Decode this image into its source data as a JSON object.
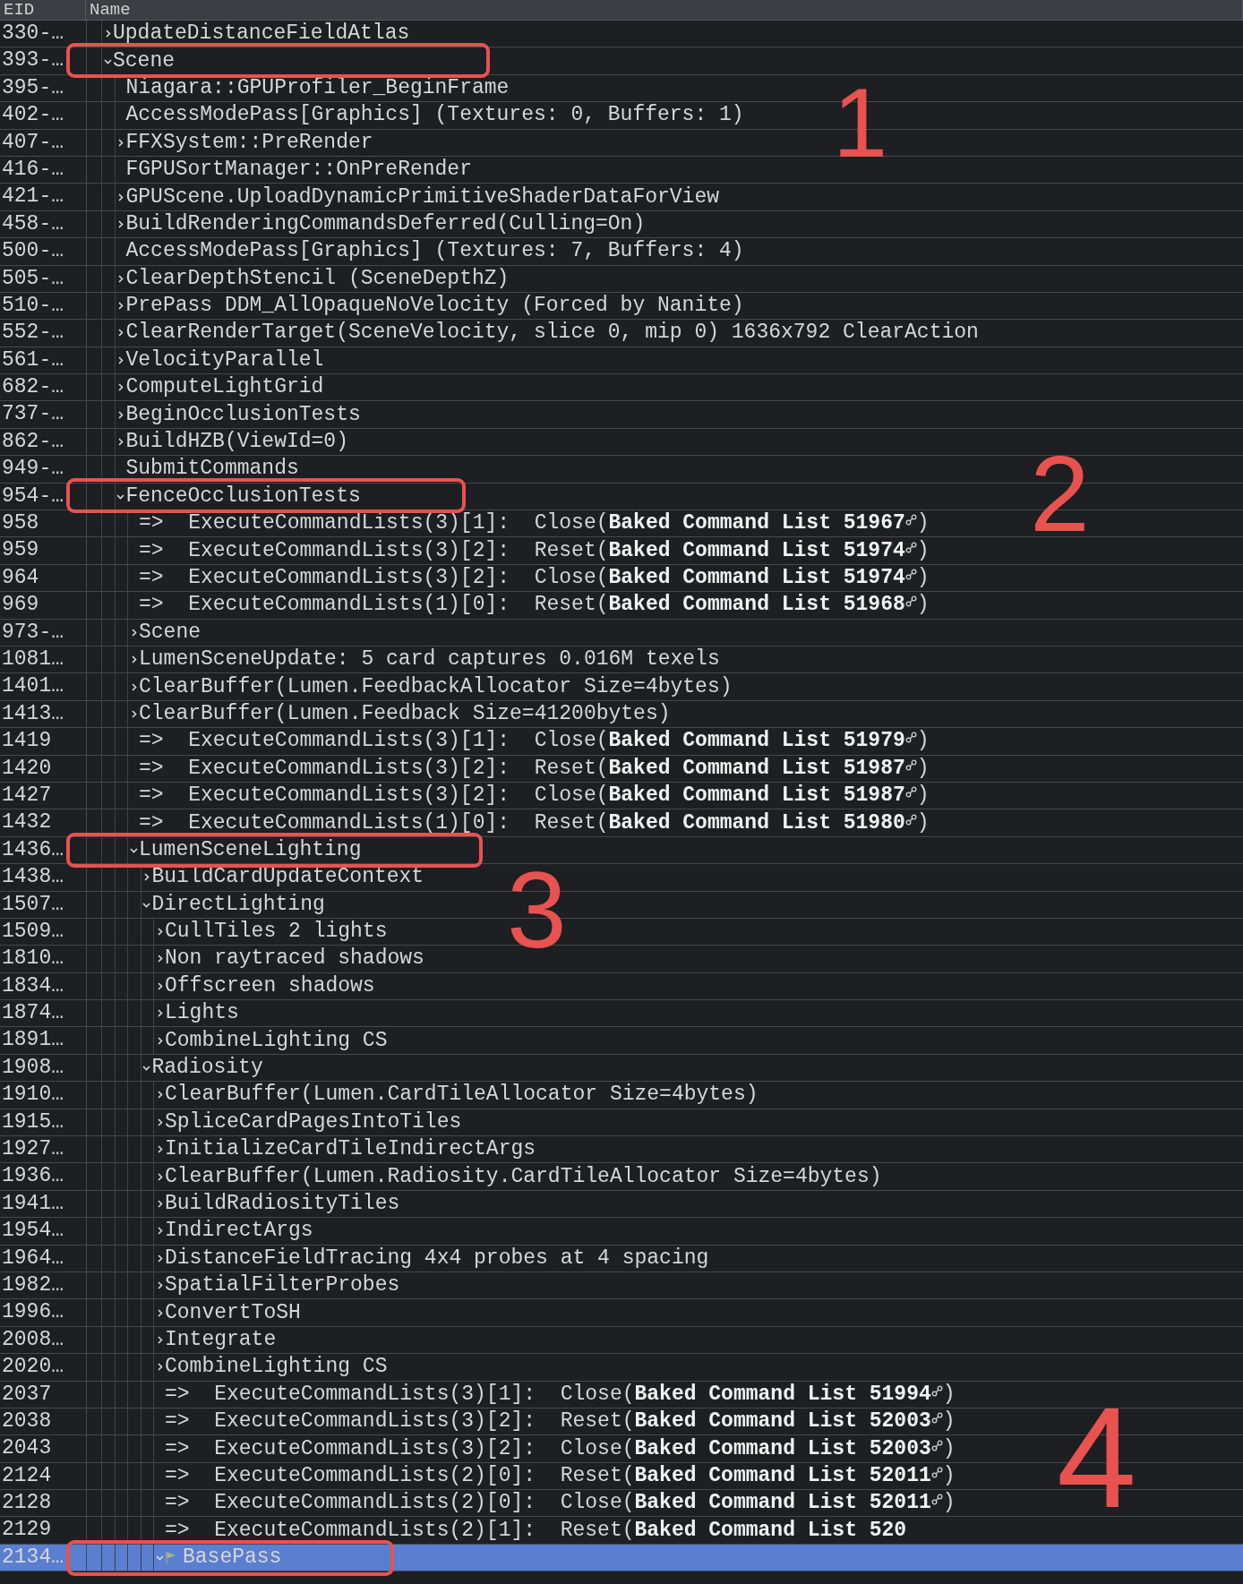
{
  "columns": [
    "EID",
    "Name"
  ],
  "events": [
    {
      "eid": "330-…",
      "kind": "event",
      "name": "UpdateDistanceFieldAtlas",
      "expanded": false,
      "selected": false
    },
    {
      "eid": "393-…",
      "kind": "event",
      "name": "Scene",
      "expanded": true,
      "selected": false,
      "children": [
        {
          "eid": "395-…",
          "kind": "event",
          "name": "Niagara::GPUProfiler_BeginFrame",
          "selected": false
        },
        {
          "eid": "402-…",
          "kind": "event",
          "name": "AccessModePass[Graphics] (Textures: 0, Buffers: 1)",
          "selected": false
        },
        {
          "eid": "407-…",
          "kind": "event",
          "name": "FFXSystem::PreRender",
          "expanded": false,
          "selected": false
        },
        {
          "eid": "416-…",
          "kind": "event",
          "name": "FGPUSortManager::OnPreRender",
          "selected": false
        },
        {
          "eid": "421-…",
          "kind": "event",
          "name": "GPUScene.UploadDynamicPrimitiveShaderDataForView",
          "expanded": false,
          "selected": false
        },
        {
          "eid": "458-…",
          "kind": "event",
          "name": "BuildRenderingCommandsDeferred(Culling=On)",
          "expanded": false,
          "selected": false
        },
        {
          "eid": "500-…",
          "kind": "event",
          "name": "AccessModePass[Graphics] (Textures: 7, Buffers: 4)",
          "selected": false
        },
        {
          "eid": "505-…",
          "kind": "event",
          "name": "ClearDepthStencil (SceneDepthZ)",
          "expanded": false,
          "selected": false
        },
        {
          "eid": "510-…",
          "kind": "event",
          "name": "PrePass DDM_AllOpaqueNoVelocity (Forced by Nanite)",
          "expanded": false,
          "selected": false
        },
        {
          "eid": "552-…",
          "kind": "event",
          "name": "ClearRenderTarget(SceneVelocity, slice 0, mip 0) 1636x792 ClearAction",
          "expanded": false,
          "selected": false
        },
        {
          "eid": "561-…",
          "kind": "event",
          "name": "VelocityParallel",
          "expanded": false,
          "selected": false
        },
        {
          "eid": "682-…",
          "kind": "event",
          "name": "ComputeLightGrid",
          "expanded": false,
          "selected": false
        },
        {
          "eid": "737-…",
          "kind": "event",
          "name": "BeginOcclusionTests",
          "expanded": false,
          "selected": false
        },
        {
          "eid": "862-…",
          "kind": "event",
          "name": "BuildHZB(ViewId=0)",
          "expanded": false,
          "selected": false
        },
        {
          "eid": "949-…",
          "kind": "event",
          "name": "SubmitCommands",
          "selected": false
        },
        {
          "eid": "954-…",
          "kind": "event",
          "name": "FenceOcclusionTests",
          "expanded": true,
          "selected": false,
          "children": [
            {
              "eid": "958",
              "kind": "command",
              "name": "=>  ExecuteCommandLists(3)[1]:  Close(**Baked Command List 51967**",
              "tail": ")",
              "selected": false
            },
            {
              "eid": "959",
              "kind": "command",
              "name": "=>  ExecuteCommandLists(3)[2]:  Reset(**Baked Command List 51974**",
              "tail": ")",
              "selected": false
            },
            {
              "eid": "964",
              "kind": "command",
              "name": "=>  ExecuteCommandLists(3)[2]:  Close(**Baked Command List 51974**",
              "tail": ")",
              "selected": false
            },
            {
              "eid": "969",
              "kind": "command",
              "name": "=>  ExecuteCommandLists(1)[0]:  Reset(**Baked Command List 51968**",
              "tail": ")",
              "selected": false
            },
            {
              "eid": "973-…",
              "kind": "event",
              "name": "Scene",
              "expanded": false,
              "selected": false
            },
            {
              "eid": "1081…",
              "kind": "event",
              "name": "LumenSceneUpdate: 5 card captures 0.016M texels",
              "expanded": false,
              "selected": false
            },
            {
              "eid": "1401…",
              "kind": "event",
              "name": "ClearBuffer(Lumen.FeedbackAllocator Size=4bytes)",
              "expanded": false,
              "selected": false
            },
            {
              "eid": "1413…",
              "kind": "event",
              "name": "ClearBuffer(Lumen.Feedback Size=41200bytes)",
              "expanded": false,
              "selected": false
            },
            {
              "eid": "1419",
              "kind": "command",
              "name": "=>  ExecuteCommandLists(3)[1]:  Close(**Baked Command List 51979**",
              "tail": ")",
              "selected": false
            },
            {
              "eid": "1420",
              "kind": "command",
              "name": "=>  ExecuteCommandLists(3)[2]:  Reset(**Baked Command List 51987**",
              "tail": ")",
              "selected": false
            },
            {
              "eid": "1427",
              "kind": "command",
              "name": "=>  ExecuteCommandLists(3)[2]:  Close(**Baked Command List 51987**",
              "tail": ")",
              "selected": false
            },
            {
              "eid": "1432",
              "kind": "command",
              "name": "=>  ExecuteCommandLists(1)[0]:  Reset(**Baked Command List 51980**",
              "tail": ")",
              "selected": false
            },
            {
              "eid": "1436…",
              "kind": "event",
              "name": "LumenSceneLighting",
              "expanded": true,
              "selected": false,
              "children": [
                {
                  "eid": "1438…",
                  "kind": "event",
                  "name": "BuildCardUpdateContext",
                  "expanded": false,
                  "selected": false
                },
                {
                  "eid": "1507…",
                  "kind": "event",
                  "name": "DirectLighting",
                  "expanded": true,
                  "selected": false,
                  "children": [
                    {
                      "eid": "1509…",
                      "kind": "event",
                      "name": "CullTiles 2 lights",
                      "expanded": false,
                      "selected": false
                    },
                    {
                      "eid": "1810…",
                      "kind": "event",
                      "name": "Non raytraced shadows",
                      "expanded": false,
                      "selected": false
                    },
                    {
                      "eid": "1834…",
                      "kind": "event",
                      "name": "Offscreen shadows",
                      "expanded": false,
                      "selected": false
                    },
                    {
                      "eid": "1874…",
                      "kind": "event",
                      "name": "Lights",
                      "expanded": false,
                      "selected": false
                    },
                    {
                      "eid": "1891…",
                      "kind": "event",
                      "name": "CombineLighting CS",
                      "expanded": false,
                      "selected": false
                    }
                  ]
                },
                {
                  "eid": "1908…",
                  "kind": "event",
                  "name": "Radiosity",
                  "expanded": true,
                  "selected": false,
                  "children": [
                    {
                      "eid": "1910…",
                      "kind": "event",
                      "name": "ClearBuffer(Lumen.CardTileAllocator Size=4bytes)",
                      "expanded": false,
                      "selected": false
                    },
                    {
                      "eid": "1915…",
                      "kind": "event",
                      "name": "SpliceCardPagesIntoTiles",
                      "expanded": false,
                      "selected": false
                    },
                    {
                      "eid": "1927…",
                      "kind": "event",
                      "name": "InitializeCardTileIndirectArgs",
                      "expanded": false,
                      "selected": false
                    },
                    {
                      "eid": "1936…",
                      "kind": "event",
                      "name": "ClearBuffer(Lumen.Radiosity.CardTileAllocator Size=4bytes)",
                      "expanded": false,
                      "selected": false
                    },
                    {
                      "eid": "1941…",
                      "kind": "event",
                      "name": "BuildRadiosityTiles",
                      "expanded": false,
                      "selected": false
                    },
                    {
                      "eid": "1954…",
                      "kind": "event",
                      "name": "IndirectArgs",
                      "expanded": false,
                      "selected": false
                    },
                    {
                      "eid": "1964…",
                      "kind": "event",
                      "name": "DistanceFieldTracing 4x4 probes at 4 spacing",
                      "expanded": false,
                      "selected": false
                    },
                    {
                      "eid": "1982…",
                      "kind": "event",
                      "name": "SpatialFilterProbes",
                      "expanded": false,
                      "selected": false
                    },
                    {
                      "eid": "1996…",
                      "kind": "event",
                      "name": "ConvertToSH",
                      "expanded": false,
                      "selected": false
                    },
                    {
                      "eid": "2008…",
                      "kind": "event",
                      "name": "Integrate",
                      "expanded": false,
                      "selected": false
                    },
                    {
                      "eid": "2020…",
                      "kind": "event",
                      "name": "CombineLighting CS",
                      "expanded": false,
                      "selected": false
                    },
                    {
                      "eid": "2037",
                      "kind": "command",
                      "name": "=>  ExecuteCommandLists(3)[1]:  Close(**Baked Command List 51994**",
                      "tail": ")",
                      "selected": false
                    },
                    {
                      "eid": "2038",
                      "kind": "command",
                      "name": "=>  ExecuteCommandLists(3)[2]:  Reset(**Baked Command List 52003**",
                      "tail": ")",
                      "selected": false
                    },
                    {
                      "eid": "2043",
                      "kind": "command",
                      "name": "=>  ExecuteCommandLists(3)[2]:  Close(**Baked Command List 52003**",
                      "tail": ")",
                      "selected": false
                    },
                    {
                      "eid": "2124",
                      "kind": "command",
                      "name": "=>  ExecuteCommandLists(2)[0]:  Reset(**Baked Command List 52011**",
                      "tail": ")",
                      "selected": false
                    },
                    {
                      "eid": "2128",
                      "kind": "command",
                      "name": "=>  ExecuteCommandLists(2)[0]:  Close(**Baked Command List 52011**",
                      "tail": ")",
                      "selected": false
                    },
                    {
                      "eid": "2129",
                      "kind": "command",
                      "name": "=>  ExecuteCommandLists(2)[1]:  Reset(**Baked Command List 520**",
                      "selected": false
                    },
                    {
                      "eid": "2134…",
                      "kind": "event",
                      "name": "BasePass",
                      "expanded": true,
                      "bookmarked": true,
                      "selected": true
                    }
                  ]
                }
              ]
            }
          ]
        }
      ]
    }
  ],
  "annotations": [
    {
      "label": "1"
    },
    {
      "label": "2"
    },
    {
      "label": "3"
    },
    {
      "label": "4"
    }
  ]
}
